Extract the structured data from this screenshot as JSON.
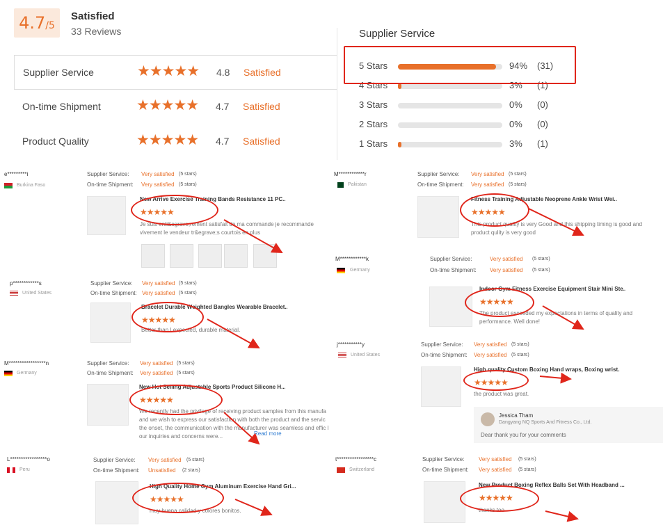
{
  "summary": {
    "score": "4.7",
    "score_suffix": "/5",
    "title": "Satisfied",
    "reviews": "33 Reviews"
  },
  "metrics": [
    {
      "label": "Supplier Service",
      "stars": "★★★★★",
      "value": "4.8",
      "state": "Satisfied"
    },
    {
      "label": "On-time Shipment",
      "stars": "★★★★★",
      "value": "4.7",
      "state": "Satisfied"
    },
    {
      "label": "Product Quality",
      "stars": "★★★★★",
      "value": "4.7",
      "state": "Satisfied"
    }
  ],
  "distribution": {
    "title": "Supplier Service",
    "rows": [
      {
        "label": "5  Stars",
        "pct": "94%",
        "count": "(31)",
        "fill": 0.94
      },
      {
        "label": "4  Stars",
        "pct": "3%",
        "count": "(1)",
        "fill": 0.03
      },
      {
        "label": "3  Stars",
        "pct": "0%",
        "count": "(0)",
        "fill": 0
      },
      {
        "label": "2  Stars",
        "pct": "0%",
        "count": "(0)",
        "fill": 0
      },
      {
        "label": "1  Stars",
        "pct": "3%",
        "count": "(1)",
        "fill": 0.03
      }
    ]
  },
  "labels": {
    "supplier_service": "Supplier Service:",
    "ontime_shipment": "On-time Shipment:",
    "five_stars": "(5 stars)",
    "two_stars": "(2 stars)",
    "stars5": "★★★★★",
    "read_more": "Read more"
  },
  "reviews": [
    {
      "user": "e*********i",
      "country": "Burkina Faso",
      "supplier": "Very satisfied",
      "shipment": "Very satisfied",
      "shipment_stars": "(5 stars)",
      "product": "New Arrive Exercise Training Bands Resistance 11 PC...",
      "text": "Je suis enti&egrave;rement satisfait de ma commande je recommande vivement le vendeur tr&egrave;s courtois en plus"
    },
    {
      "user": "p************s",
      "country": "United States",
      "supplier": "Very satisfied",
      "shipment": "Very satisfied",
      "shipment_stars": "(5 stars)",
      "product": "Bracelet Durable Weighted Bangles Wearable Bracelet...",
      "text": "Better than I expected, durable material."
    },
    {
      "user": "M*****************n",
      "country": "Germany",
      "supplier": "Very satisfied",
      "shipment": "Very satisfied",
      "shipment_stars": "(5 stars)",
      "product": "New Hot Selling Adjustable Sports Product Silicone H...",
      "text": "We recently had the privilege of receiving product samples from this manufa and we wish to express our satisfaction with both the product and the servic the onset, the communication with the manufacturer was seamless and effic l our inquiries and concerns were..."
    },
    {
      "user": "L*****************o",
      "country": "Peru",
      "supplier": "Very satisfied",
      "shipment": "Unsatisfied",
      "shipment_stars": "(2 stars)",
      "product": "High Quality Home Gym Aluminum Exercise Hand Gri...",
      "text": "muy buena calidad y colores bonitos."
    },
    {
      "user": "M************r",
      "country": "Pakistan",
      "supplier": "Very satisfied",
      "shipment": "Very satisfied",
      "shipment_stars": "(5 stars)",
      "product": "Fitness Training Adjustable Neoprene Ankle Wrist Wei...",
      "text": "This product quality is very Good and this shipping timing is good and product qulity is very good"
    },
    {
      "user": "M************k",
      "country": "Germany",
      "supplier": "Very satisfied",
      "shipment": "Very satisfied",
      "shipment_stars": "(5 stars)",
      "product": "Indoor Gym Fitness Exercise Equipment Stair Mini Ste...",
      "text": "The product exceeded my expectations in terms of quality and performance. Well done!"
    },
    {
      "user": "j***********y",
      "country": "United States",
      "supplier": "Very satisfied",
      "shipment": "Very satisfied",
      "shipment_stars": "(5 stars)",
      "product": "High quality Custom Boxing Hand wraps, Boxing wrist...",
      "text": "the product was great.",
      "reply": {
        "name": "Jessica Tham",
        "company": "Dangyang NQ Sports And Fitness Co., Ltd.",
        "text": "Dear thank you for your comments"
      }
    },
    {
      "user": "t*****************c",
      "country": "Switzerland",
      "supplier": "Very satisfied",
      "shipment": "Very satisfied",
      "shipment_stars": "(5 stars)",
      "product": "New Product Boxing Reflex Balls Set With Headband ...",
      "text": "thanks too"
    }
  ],
  "colors": {
    "accent": "#e8702a",
    "annotation": "#e0261b"
  }
}
